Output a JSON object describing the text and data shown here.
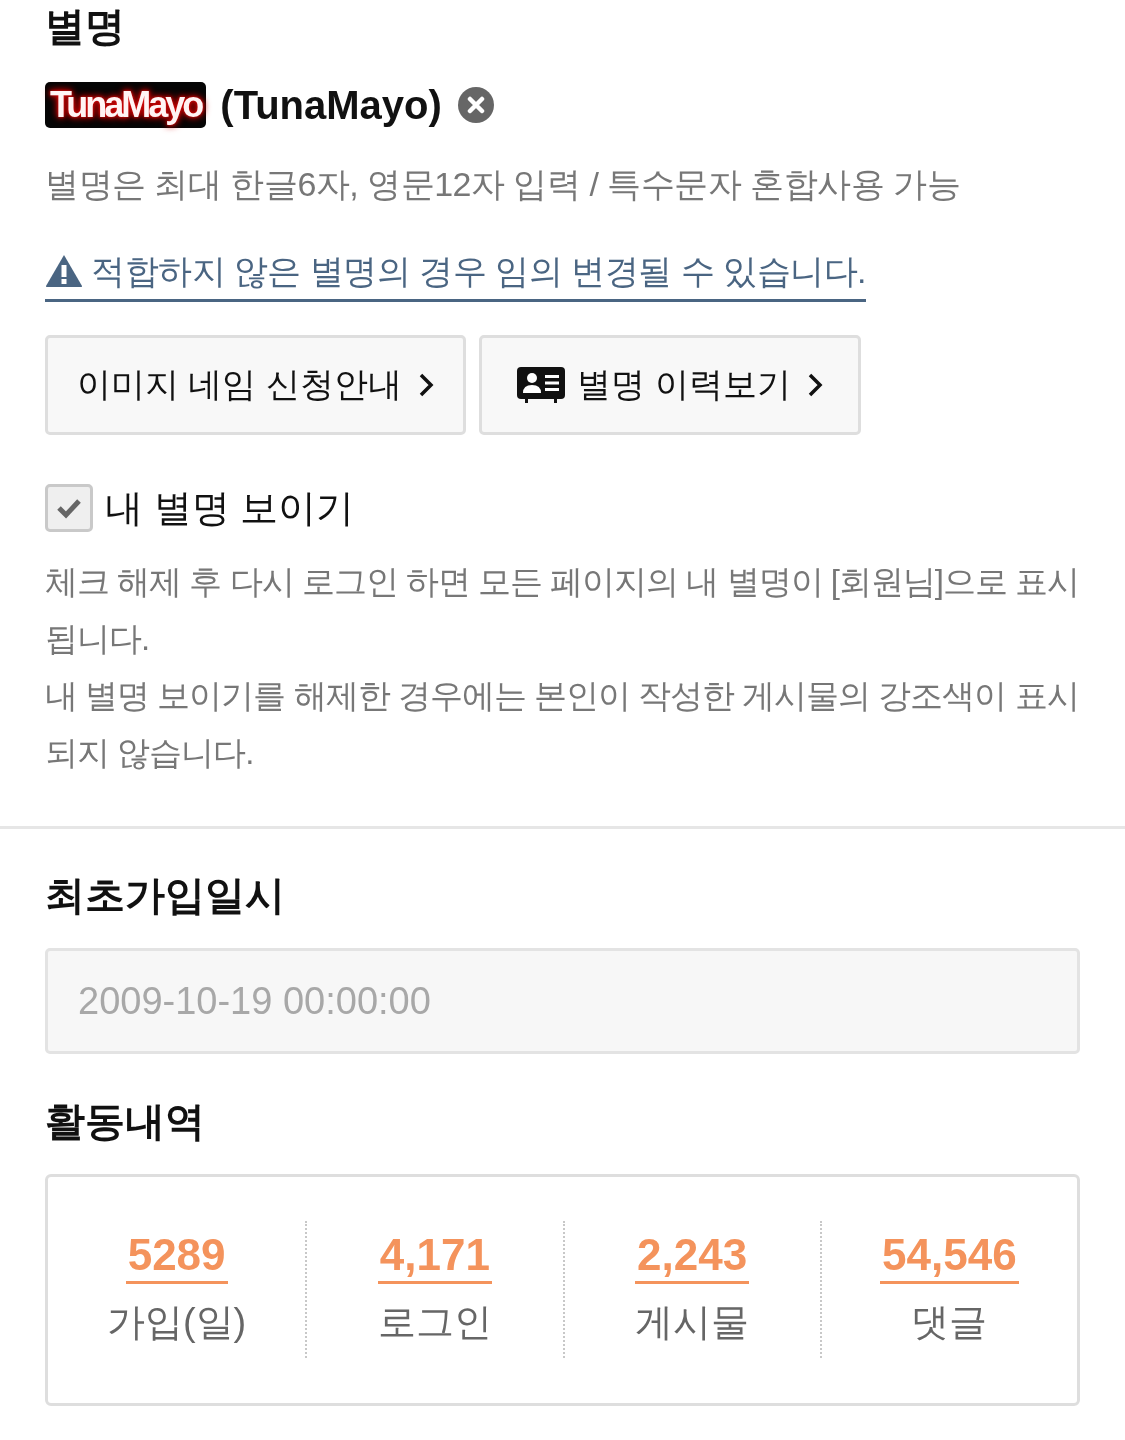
{
  "nickname_section": {
    "title": "별명",
    "image_name": "TunaMayo",
    "nickname": "(TunaMayo)",
    "hint": "별명은 최대 한글6자, 영문12자 입력 / 특수문자 혼합사용 가능",
    "warning_link": "적합하지 않은 별명의 경우 임의 변경될 수 있습니다.",
    "buttons": [
      {
        "kind": "plain",
        "label": "이미지 네임 신청안내"
      },
      {
        "kind": "history",
        "label": "별명 이력보기"
      }
    ],
    "show_nickname": {
      "label": "내 별명 보이기",
      "checked": true
    },
    "notes": [
      "체크 해제 후 다시 로그인 하면 모든 페이지의 내 별명이 [회원님]으로 표시됩니다.",
      "내 별명 보이기를 해제한 경우에는 본인이 작성한 게시물의 강조색이 표시되지 않습니다."
    ]
  },
  "join_date": {
    "title": "최초가입일시",
    "value": "2009-10-19 00:00:00"
  },
  "activity": {
    "title": "활동내역",
    "stats": [
      {
        "value": "5289",
        "label": "가입(일)"
      },
      {
        "value": "4,171",
        "label": "로그인"
      },
      {
        "value": "2,243",
        "label": "게시물"
      },
      {
        "value": "54,546",
        "label": "댓글"
      }
    ]
  }
}
